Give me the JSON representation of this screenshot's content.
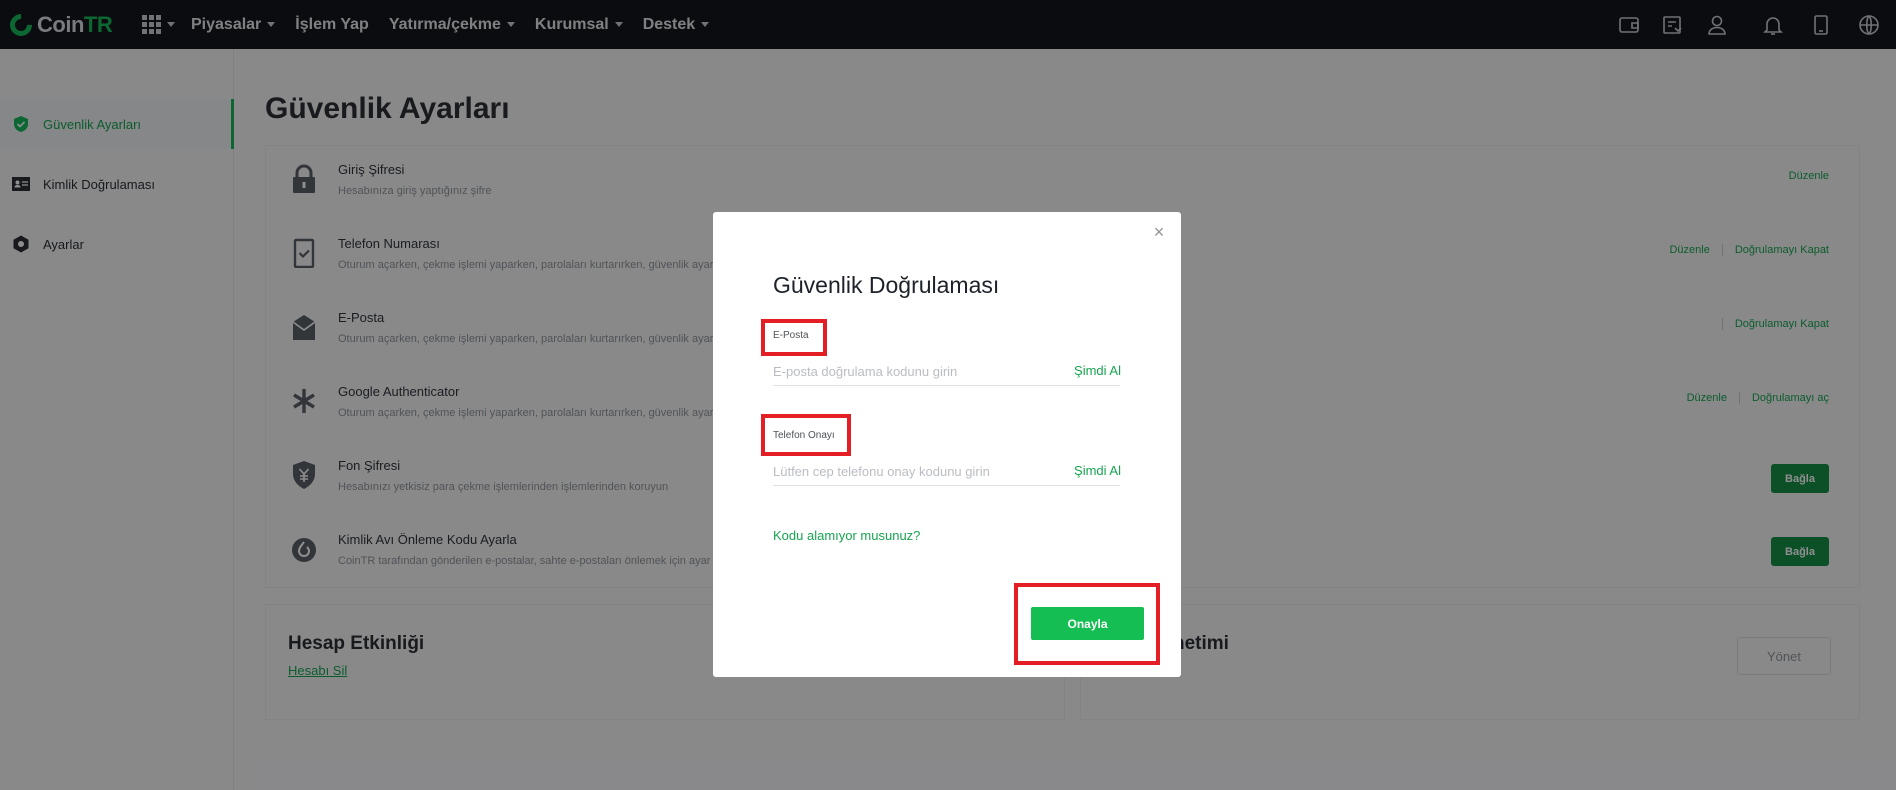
{
  "nav": {
    "logo_main": "Coin",
    "logo_accent": "TR",
    "menu": [
      "Piyasalar",
      "İşlem Yap",
      "Yatırma/çekme",
      "Kurumsal",
      "Destek"
    ],
    "icons": [
      "wallet-icon",
      "orders-icon",
      "user-icon",
      "bell-icon",
      "download-app-icon",
      "globe-icon"
    ]
  },
  "sidebar": {
    "items": [
      {
        "label": "Güvenlik Ayarları",
        "icon": "shield-icon",
        "active": true
      },
      {
        "label": "Kimlik Doğrulaması",
        "icon": "id-card-icon",
        "active": false
      },
      {
        "label": "Ayarlar",
        "icon": "gear-icon",
        "active": false
      }
    ]
  },
  "page": {
    "title": "Güvenlik Ayarları",
    "rows": [
      {
        "title": "Giriş Şifresi",
        "desc": "Hesabınıza giriş yaptığınız şifre",
        "actions": [
          "Düzenle"
        ]
      },
      {
        "title": "Telefon Numarası",
        "desc": "Oturum açarken, çekme işlemi yaparken, parolaları kurtarırken, güvenlik ayar",
        "actions": [
          "Düzenle",
          "Doğrulamayı Kapat"
        ]
      },
      {
        "title": "E-Posta",
        "desc": "Oturum açarken, çekme işlemi yaparken, parolaları kurtarırken, güvenlik ayar",
        "actions": [
          "Doğrulamayı Kapat"
        ]
      },
      {
        "title": "Google Authenticator",
        "desc": "Oturum açarken, çekme işlemi yaparken, parolaları kurtarırken, güvenlik ayar",
        "actions": [
          "Düzenle",
          "Doğrulamayı aç"
        ]
      },
      {
        "title": "Fon Şifresi",
        "desc": "Hesabınızı yetkisiz para çekme işlemlerinden işlemlerinden koruyun",
        "button": "Bağla"
      },
      {
        "title": "Kimlik Avı Önleme Kodu Ayarla",
        "desc": "CoinTR tarafından gönderilen e-postalar, sahte e-postaları önlemek için ayar",
        "button": "Bağla"
      }
    ],
    "activity": {
      "title": "Hesap Etkinliği",
      "link": "Hesabı Sil"
    },
    "device": {
      "title_partial": "netimi",
      "button": "Yönet"
    }
  },
  "modal": {
    "title": "Güvenlik Doğrulaması",
    "email_label": "E-Posta",
    "email_placeholder": "E-posta doğrulama kodunu girin",
    "email_get_code": "Şimdi Al",
    "phone_label": "Telefon Onayı",
    "phone_placeholder": "Lütfen cep telefonu onay kodunu girin",
    "phone_get_code": "Şimdi Al",
    "no_code_link": "Kodu alamıyor musunuz?",
    "confirm_button": "Onayla",
    "close_glyph": "×"
  },
  "colors": {
    "brand_green": "#17b85a",
    "link_green": "#17a550",
    "highlight_red": "#e31e25",
    "topbar": "#14171c"
  }
}
